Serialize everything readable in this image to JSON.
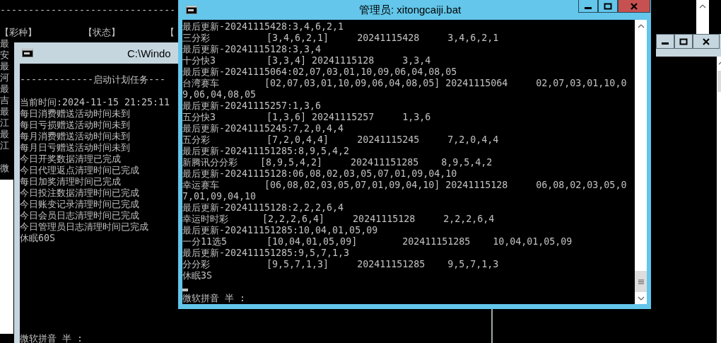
{
  "background_window": {
    "divider": "-------------------------------",
    "headers": [
      "【彩种】",
      "【状态】",
      "【"
    ],
    "row_fragments": [
      "最",
      "安",
      "最",
      "河",
      "最",
      "吉",
      "最",
      "江",
      "最",
      "江"
    ],
    "ime_fragment": "微"
  },
  "task_window": {
    "title": "C:\\Windo",
    "heading": "-------------启动计划任务---",
    "lines": [
      "当前时间:2024-11-15 21:25:11",
      "每日消费赠送活动时间未到",
      "每日亏损赠送活动时间未到",
      "每月消费赠送活动时间未到",
      "每月日亏赠送活动时间未到",
      "今日开奖数据清理已完成",
      "今日代理返点清理时间已完成",
      "每日加奖清理时间已完成",
      "今日投注数据清理时间已完成",
      "今日账变记录清理时间已完成",
      "今日会员日志清理时间已完成",
      "今日管理员日志清理时间已完成",
      "休眠60S"
    ],
    "ime_status": "微软拼音 半 :"
  },
  "main_window": {
    "title": "管理员: xitongcaiji.bat",
    "lines": [
      "最后更新-20241115428:3,4,6,2,1",
      "三分彩          [3,4,6,2,1]     20241115428     3,4,6,2,1",
      "最后更新-20241115128:3,3,4",
      "十分快3         [3,3,4] 20241115128     3,3,4",
      "最后更新-20241115064:02,07,03,01,10,09,06,04,08,05",
      "台湾赛车        [02,07,03,01,10,09,06,04,08,05] 20241115064     02,07,03,01,10,0",
      "9,06,04,08,05",
      "最后更新-20241115257:1,3,6",
      "五分快3         [1,3,6] 20241115257     1,3,6",
      "最后更新-20241115245:7,2,0,4,4",
      "五分彩          [7,2,0,4,4]     20241115245     7,2,0,4,4",
      "最后更新-202411151285:8,9,5,4,2",
      "新腾讯分分彩    [8,9,5,4,2]     202411151285    8,9,5,4,2",
      "最后更新-20241115128:06,08,02,03,05,07,01,09,04,10",
      "幸运赛车        [06,08,02,03,05,07,01,09,04,10] 20241115128     06,08,02,03,05,0",
      "7,01,09,04,10",
      "最后更新-20241115128:2,2,2,6,4",
      "幸运时时彩      [2,2,2,6,4]     20241115128     2,2,2,6,4",
      "最后更新-202411151285:10,04,01,05,09",
      "一分11选5       [10,04,01,05,09]        202411151285    10,04,01,05,09",
      "最后更新-202411151285:9,5,7,1,3",
      "分分彩          [9,5,7,1,3]     202411151285    9,5,7,1,3",
      "休眠3S"
    ],
    "ime_status": "微软拼音 半 :"
  }
}
